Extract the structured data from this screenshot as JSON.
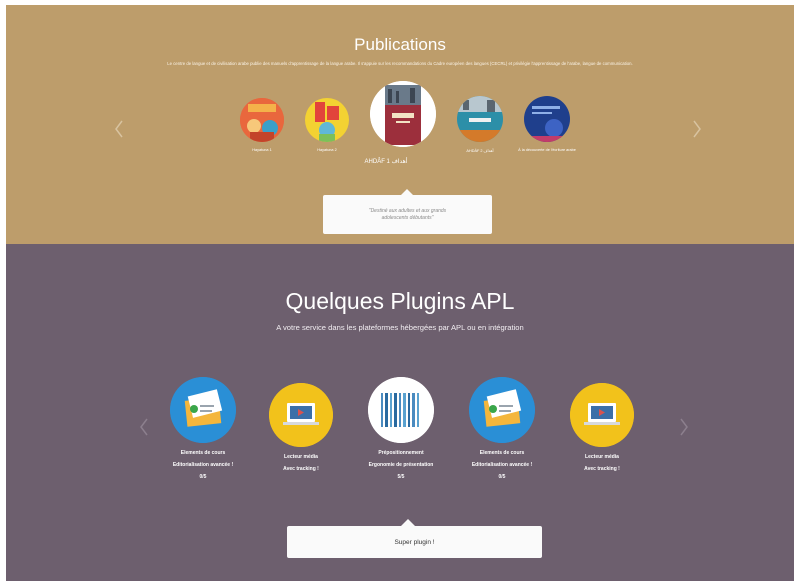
{
  "publications": {
    "title": "Publications",
    "description": "Le centre de langue et de civilisation arabe publie des manuels d'apprentissage de la langue arabe. Il s'appuie sur les recommandations du Cadre européen des langues (CECRL) et privilégie l'apprentissage de l'arabe, langue de communication.",
    "books": [
      {
        "caption": "Hayatuna 1",
        "icon": "book-cover-hayatuna-icon"
      },
      {
        "caption": "Hayatuna 2",
        "icon": "book-cover-hayatuna-2-icon"
      },
      {
        "caption": "AHDÂF 1 أهداف",
        "icon": "book-cover-ahdaf-icon"
      },
      {
        "caption": "AHDÂF 2 أهداف",
        "icon": "book-cover-ahdaf-2-icon"
      },
      {
        "caption": "À la découverte de l'écriture arabe",
        "icon": "book-cover-ecriture-icon"
      }
    ],
    "quote": "\"Destiné aux adultes et aux grands adolescents débutants\""
  },
  "plugins": {
    "title": "Quelques Plugins APL",
    "subtitle": "A votre service dans les plateformes hébergées par APL ou en intégration",
    "items": [
      {
        "lines": [
          "Elements de cours",
          "Editorialisation avancée !",
          "0/5"
        ],
        "icon": "course-elements-icon"
      },
      {
        "lines": [
          "Lecteur média",
          "Avec tracking !"
        ],
        "icon": "media-player-icon"
      },
      {
        "lines": [
          "Prépositionnement",
          "Ergonomie de présentation",
          "5/5"
        ],
        "icon": "positioning-bars-icon"
      },
      {
        "lines": [
          "Elements de cours",
          "Editorialisation avancée !",
          "0/5"
        ],
        "icon": "course-elements-icon"
      },
      {
        "lines": [
          "Lecteur média",
          "Avec tracking !"
        ],
        "icon": "media-player-icon"
      }
    ],
    "quote": "Super plugin !"
  },
  "colors": {
    "publications_bg": "#bd9d6b",
    "plugins_bg": "#6d5f6e",
    "plugin_blue": "#2a8fd6",
    "plugin_yellow": "#f2c21b"
  }
}
